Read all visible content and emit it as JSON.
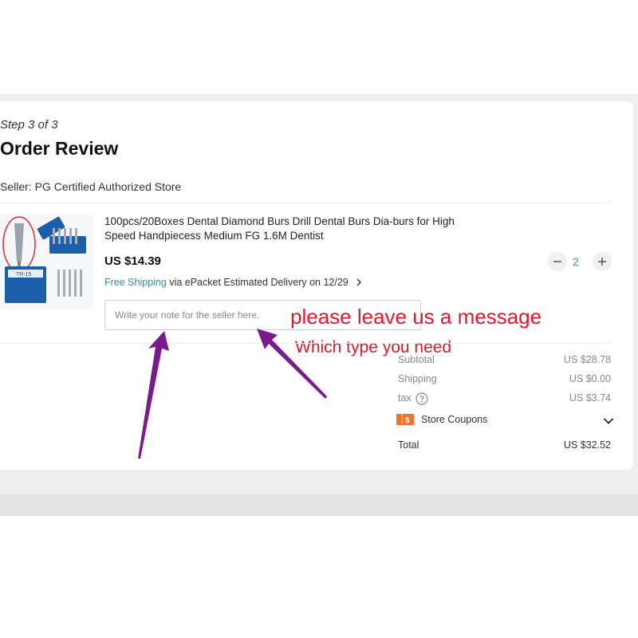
{
  "order": {
    "step": "Step 3 of 3",
    "title": "Order Review",
    "seller": "Seller: PG Certified Authorized Store"
  },
  "product": {
    "name": "100pcs/20Boxes Dental Diamond Burs Drill Dental Burs Dia-burs for High Speed Handpiecess Medium FG 1.6M Dentist",
    "price": "US $14.39",
    "quantity": "2",
    "image_label": "TR-15",
    "shipping": {
      "free": "Free Shipping",
      "via": "via ePacket",
      "estimated": "Estimated Delivery on 12/29"
    },
    "note_placeholder": "Write your note for the seller here."
  },
  "annotations": {
    "message": "please leave us a message",
    "type": "Which type you need",
    "color": "#e3172c",
    "arrow_color": "#7b1a8c"
  },
  "summary": {
    "subtotal_label": "Subtotal",
    "subtotal_value": "US $28.78",
    "shipping_label": "Shipping",
    "shipping_value": "US $0.00",
    "tax_label": "tax",
    "tax_value": "US $3.74",
    "coupons_label": "Store Coupons",
    "coupon_icon_text": "$",
    "total_label": "Total",
    "total_value": "US $32.52"
  },
  "icons": {
    "chevron_right": "chevron-right-icon",
    "help": "question-circle-icon",
    "coupon": "coupon-ticket-icon",
    "chevron_down": "chevron-down-icon",
    "minus": "minus-icon",
    "plus": "plus-icon"
  },
  "colors": {
    "accent_teal": "#2a8fa8",
    "coupon_orange": "#f57224"
  }
}
